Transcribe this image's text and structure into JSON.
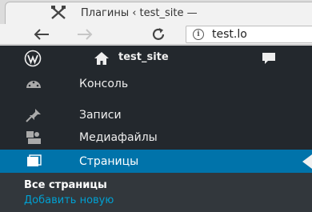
{
  "browser": {
    "tab_title": "Плагины ‹ test_site —",
    "url": "test.lo"
  },
  "adminbar": {
    "site_name": "test_site"
  },
  "menu": {
    "items": [
      {
        "label": "Консоль",
        "icon": "dashboard-icon"
      },
      {
        "label": "Записи",
        "icon": "pushpin-icon"
      },
      {
        "label": "Медиафайлы",
        "icon": "media-icon"
      },
      {
        "label": "Страницы",
        "icon": "pages-icon",
        "active": true
      }
    ],
    "submenu": {
      "all_pages": "Все страницы",
      "add_new": "Добавить новую"
    }
  },
  "colors": {
    "admin_bg": "#23282d",
    "active_bg": "#0073aa",
    "submenu_bg": "#32373c",
    "link": "#00a0d2"
  }
}
